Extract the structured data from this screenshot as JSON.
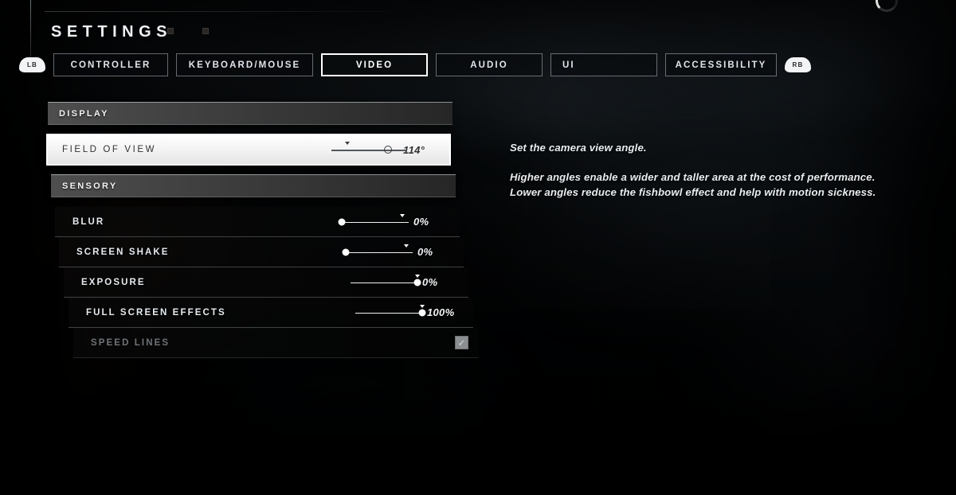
{
  "header": {
    "title": "SETTINGS",
    "dots": [
      "dot-1",
      "dot-2"
    ],
    "left_bumper": "LB",
    "right_bumper": "RB"
  },
  "tabs": [
    {
      "id": "controller",
      "label": "CONTROLLER",
      "active": false
    },
    {
      "id": "keyboard",
      "label": "KEYBOARD/MOUSE",
      "active": false
    },
    {
      "id": "video",
      "label": "VIDEO",
      "active": true
    },
    {
      "id": "audio",
      "label": "AUDIO",
      "active": false
    },
    {
      "id": "ui",
      "label": "UI",
      "active": false
    },
    {
      "id": "accessibility",
      "label": "ACCESSIBILITY",
      "active": false
    }
  ],
  "sections": [
    {
      "id": "display",
      "header": "DISPLAY",
      "rows": [
        {
          "id": "field-of-view",
          "label": "FIELD OF VIEW",
          "type": "slider",
          "value": "114°",
          "percent": 84,
          "default_marker": 24,
          "selected": true,
          "disabled": false
        }
      ]
    },
    {
      "id": "sensory",
      "header": "SENSORY",
      "rows": [
        {
          "id": "blur",
          "label": "BLUR",
          "type": "slider",
          "value": "0%",
          "percent": 0,
          "default_marker": 90,
          "selected": false,
          "disabled": false
        },
        {
          "id": "screen-shake",
          "label": "SCREEN SHAKE",
          "type": "slider",
          "value": "0%",
          "percent": 0,
          "default_marker": 90,
          "selected": false,
          "disabled": false
        },
        {
          "id": "exposure",
          "label": "EXPOSURE",
          "type": "slider",
          "value": "0%",
          "percent": 100,
          "default_marker": 100,
          "selected": false,
          "disabled": false
        },
        {
          "id": "full-screen-effects",
          "label": "FULL SCREEN EFFECTS",
          "type": "slider",
          "value": "100%",
          "percent": 100,
          "default_marker": 100,
          "selected": false,
          "disabled": false
        },
        {
          "id": "speed-lines",
          "label": "SPEED LINES",
          "type": "checkbox",
          "checked": true,
          "check_glyph": "✓",
          "selected": false,
          "disabled": true
        }
      ]
    }
  ],
  "description": {
    "line1": "Set the camera view angle.",
    "line2": "Higher angles enable a wider and taller area at the cost of performance.",
    "line3": "Lower angles reduce the fishbowl effect and help with motion sickness."
  },
  "colors": {
    "accent_selected": "#ffffff",
    "tab_border": "#bec8d0",
    "section_header_from": "#4e4e4e",
    "section_header_to": "#262626",
    "text_primary": "#e6ebef",
    "text_disabled": "#6e7378",
    "checkbox_fill": "#8c8f92"
  }
}
